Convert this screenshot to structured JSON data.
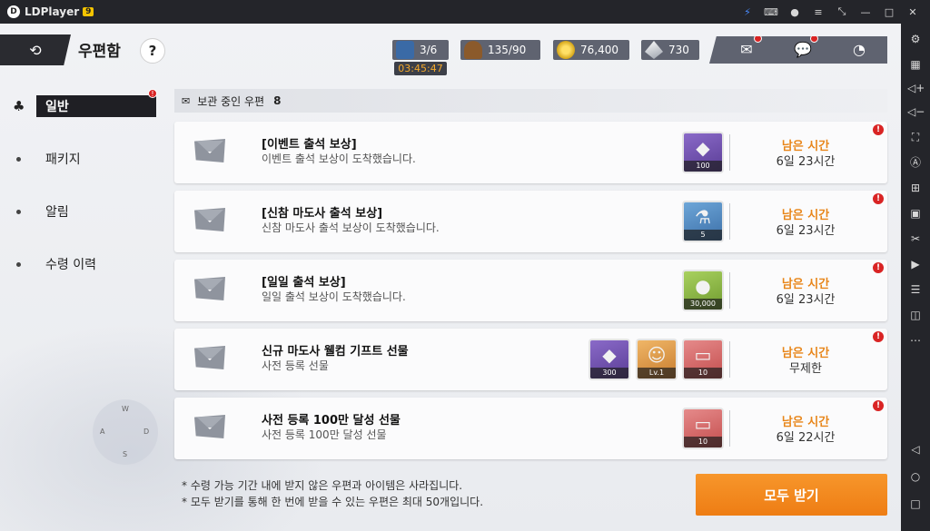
{
  "emulator": {
    "app_name": "LDPlayer",
    "version_badge": "9"
  },
  "header": {
    "title": "우편함",
    "help": "?",
    "resources": {
      "stamina": "3/6",
      "stamina_timer": "03:45:47",
      "boots": "135/90",
      "gold": "76,400",
      "gems": "730"
    }
  },
  "tabs": [
    {
      "label": "일반",
      "active": true
    },
    {
      "label": "패키지",
      "active": false
    },
    {
      "label": "알림",
      "active": false
    },
    {
      "label": "수령 이력",
      "active": false
    }
  ],
  "mail_count": {
    "label": "보관 중인 우편",
    "count": "8"
  },
  "mails": [
    {
      "title": "[이벤트 출석 보상]",
      "subtitle": "이벤트 출석 보상이 도착했습니다.",
      "remain_label": "남은 시간",
      "remain_value": "6일 23시간",
      "items": [
        {
          "qty": "100",
          "color": "purple",
          "icon": "crystal-icon"
        }
      ]
    },
    {
      "title": "[신참 마도사 출석 보상]",
      "subtitle": "신참 마도사 출석 보상이 도착했습니다.",
      "remain_label": "남은 시간",
      "remain_value": "6일 23시간",
      "items": [
        {
          "qty": "5",
          "color": "blue",
          "icon": "potion-icon"
        }
      ]
    },
    {
      "title": "[일일 출석 보상]",
      "subtitle": "일일 출석 보상이 도착했습니다.",
      "remain_label": "남은 시간",
      "remain_value": "6일 23시간",
      "items": [
        {
          "qty": "30,000",
          "color": "green",
          "icon": "gold-coin-icon"
        }
      ]
    },
    {
      "title": "신규 마도사 웰컴 기프트 선물",
      "subtitle": "사전 등록 선물",
      "remain_label": "남은 시간",
      "remain_value": "무제한",
      "items": [
        {
          "qty": "300",
          "color": "purple",
          "icon": "crystal-icon"
        },
        {
          "qty": "Lv.1",
          "color": "orange",
          "icon": "character-portrait-icon"
        },
        {
          "qty": "10",
          "color": "red",
          "icon": "ticket-icon"
        }
      ]
    },
    {
      "title": "사전 등록 100만 달성 선물",
      "subtitle": "사전 등록 100만 달성 선물",
      "remain_label": "남은 시간",
      "remain_value": "6일 22시간",
      "items": [
        {
          "qty": "10",
          "color": "red",
          "icon": "ticket-icon"
        }
      ]
    }
  ],
  "footer": {
    "note_1": "* 수령 가능 기간 내에 받지 않은 우편과 아이템은 사라집니다.",
    "note_2": "* 모두 받기를 통해 한 번에 받을 수 있는 우편은 최대 50개입니다.",
    "claim_all_label": "모두 받기"
  },
  "joystick": {
    "up": "W",
    "left": "A",
    "right": "D",
    "down": "S"
  }
}
